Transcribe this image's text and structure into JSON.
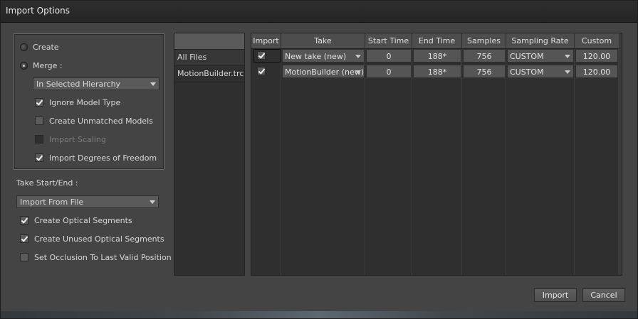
{
  "window": {
    "title": "Import Options"
  },
  "options": {
    "create_label": "Create",
    "merge_label": "Merge :",
    "merge_mode": "In Selected Hierarchy",
    "ignore_model_type": "Ignore Model Type",
    "create_unmatched_models": "Create Unmatched Models",
    "import_scaling": "Import Scaling",
    "import_degrees_of_freedom": "Import Degrees of Freedom"
  },
  "take_start_end": {
    "label": "Take Start/End :",
    "value": "Import From File",
    "create_optical_segments": "Create Optical Segments",
    "create_unused_optical_segments": "Create Unused Optical Segments",
    "set_occlusion": "Set Occlusion To Last Valid Position"
  },
  "files": [
    "All Files",
    "MotionBuilder.trc"
  ],
  "table": {
    "headers": [
      "Import",
      "Take",
      "Start Time",
      "End Time",
      "Samples",
      "Sampling Rate",
      "Custom"
    ],
    "rows": [
      {
        "import": true,
        "take": "New take (new)",
        "start": "0",
        "end": "188*",
        "samples": "756",
        "rate": "CUSTOM",
        "custom": "120.00"
      },
      {
        "import": true,
        "take": "MotionBuilder (new)",
        "start": "0",
        "end": "188*",
        "samples": "756",
        "rate": "CUSTOM",
        "custom": "120.00"
      }
    ]
  },
  "buttons": {
    "import": "Import",
    "cancel": "Cancel"
  },
  "icons": {
    "check": "checkmark-icon",
    "dropdown": "chevron-down-icon"
  }
}
